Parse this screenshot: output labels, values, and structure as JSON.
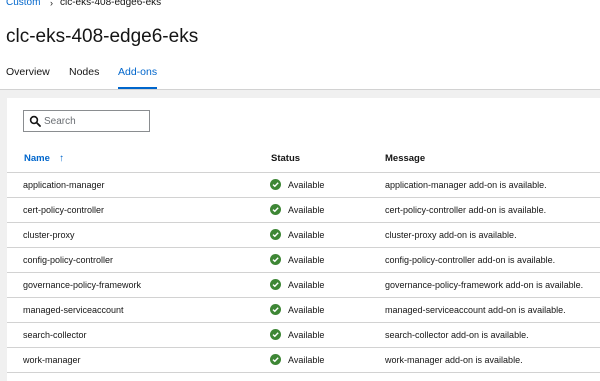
{
  "breadcrumb": {
    "parent": "Custom",
    "separator": "›",
    "current": "clc-eks-408-edge6-eks"
  },
  "page": {
    "title": "clc-eks-408-edge6-eks"
  },
  "tabs": [
    {
      "label": "Overview",
      "active": false
    },
    {
      "label": "Nodes",
      "active": false
    },
    {
      "label": "Add-ons",
      "active": true
    }
  ],
  "search": {
    "placeholder": "Search",
    "value": ""
  },
  "table": {
    "columns": {
      "name": "Name",
      "status": "Status",
      "message": "Message"
    },
    "rows": [
      {
        "name": "application-manager",
        "status": "Available",
        "message": "application-manager add-on is available."
      },
      {
        "name": "cert-policy-controller",
        "status": "Available",
        "message": "cert-policy-controller add-on is available."
      },
      {
        "name": "cluster-proxy",
        "status": "Available",
        "message": "cluster-proxy add-on is available."
      },
      {
        "name": "config-policy-controller",
        "status": "Available",
        "message": "config-policy-controller add-on is available."
      },
      {
        "name": "governance-policy-framework",
        "status": "Available",
        "message": "governance-policy-framework add-on is available."
      },
      {
        "name": "managed-serviceaccount",
        "status": "Available",
        "message": "managed-serviceaccount add-on is available."
      },
      {
        "name": "search-collector",
        "status": "Available",
        "message": "search-collector add-on is available."
      },
      {
        "name": "work-manager",
        "status": "Available",
        "message": "work-manager add-on is available."
      }
    ]
  },
  "colors": {
    "link": "#0066cc",
    "success": "#3e8635",
    "border": "#d2d2d2",
    "background": "#f0f0f0"
  }
}
